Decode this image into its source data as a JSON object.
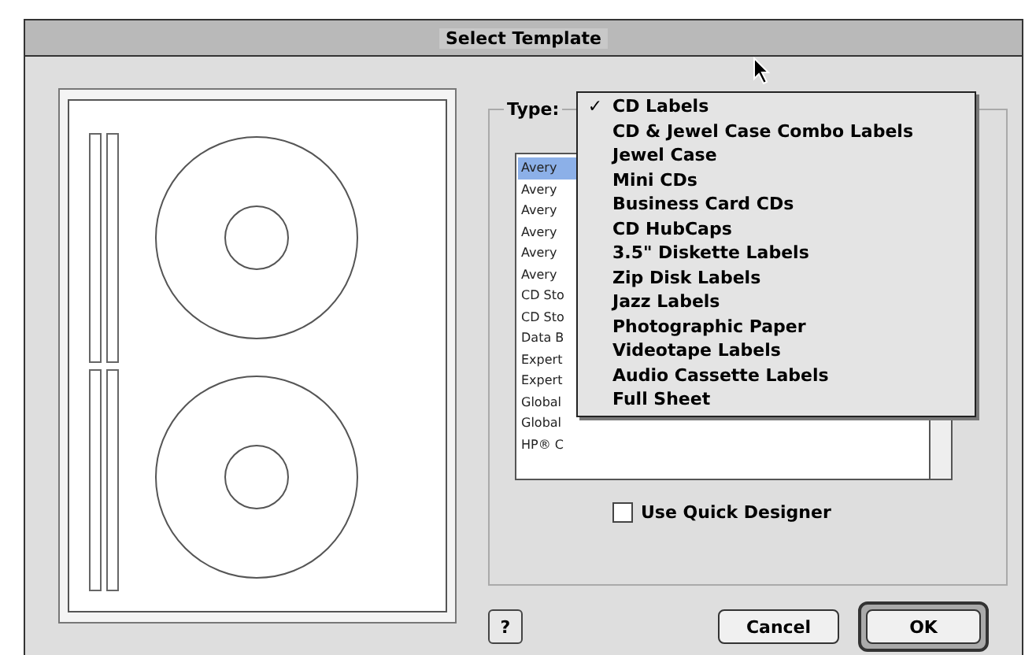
{
  "window": {
    "title": "Select Template"
  },
  "type_label": "Type:",
  "type_menu": [
    {
      "label": "CD Labels",
      "selected": true
    },
    {
      "label": "CD & Jewel Case Combo Labels",
      "selected": false
    },
    {
      "label": "Jewel Case",
      "selected": false
    },
    {
      "label": "Mini CDs",
      "selected": false
    },
    {
      "label": "Business Card CDs",
      "selected": false
    },
    {
      "label": "CD HubCaps",
      "selected": false
    },
    {
      "label": "3.5\" Diskette Labels",
      "selected": false
    },
    {
      "label": "Zip Disk Labels",
      "selected": false
    },
    {
      "label": "Jazz Labels",
      "selected": false
    },
    {
      "label": "Photographic Paper",
      "selected": false
    },
    {
      "label": "Videotape Labels",
      "selected": false
    },
    {
      "label": "Audio Cassette Labels",
      "selected": false
    },
    {
      "label": "Full Sheet",
      "selected": false
    }
  ],
  "check_mark": "✓",
  "template_list": [
    {
      "label": "Avery",
      "selected": true
    },
    {
      "label": "Avery",
      "selected": false
    },
    {
      "label": "Avery",
      "selected": false
    },
    {
      "label": "Avery",
      "selected": false
    },
    {
      "label": "Avery",
      "selected": false
    },
    {
      "label": "Avery",
      "selected": false
    },
    {
      "label": "CD Sto",
      "selected": false
    },
    {
      "label": "CD Sto",
      "selected": false
    },
    {
      "label": "Data B",
      "selected": false
    },
    {
      "label": "Expert",
      "selected": false
    },
    {
      "label": "Expert",
      "selected": false
    },
    {
      "label": "Global",
      "selected": false
    },
    {
      "label": "Global",
      "selected": false
    },
    {
      "label": "HP® C",
      "selected": false
    }
  ],
  "quick_designer": {
    "label": "Use Quick Designer",
    "checked": false
  },
  "help_button": "?",
  "buttons": [
    {
      "label": "Cancel",
      "default": false
    },
    {
      "label": "OK",
      "default": true
    }
  ]
}
